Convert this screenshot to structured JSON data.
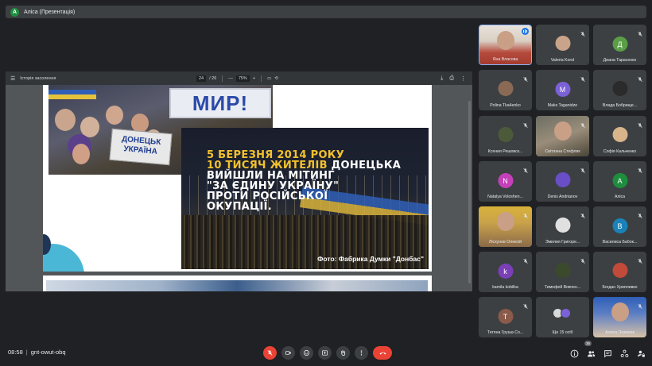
{
  "presenter": {
    "initial": "A",
    "label": "Аліса (Презентація)",
    "avatar_color": "#1e8e3e"
  },
  "pdf": {
    "title": "Історія засолення",
    "page_current": "24",
    "page_total": "/ 26",
    "zoom": "75%",
    "zoom_out": "—",
    "zoom_in": "+",
    "headline_lines": [
      {
        "text": "5 БЕРЕЗНЯ 2014 РОКУ",
        "color": "yellow"
      },
      {
        "text_y": "10 ТИСЯЧ ЖИТЕЛІВ ",
        "text_w": "ДОНЕЦЬКА"
      },
      {
        "text": "ВИЙШЛИ НА МІТИНГ",
        "color": "white"
      },
      {
        "text": "\"ЗА ЄДИНУ УКРАЇНУ\"",
        "color": "white"
      },
      {
        "text": "ПРОТИ РОСІЙСЬКОЇ",
        "color": "white"
      },
      {
        "text": "ОКУПАЦІЇ.",
        "color": "white"
      }
    ],
    "photo_caption": "Фото: Фабрика Думки \"Донбас\"",
    "sign_myr": "МИР!",
    "sign_donetsk": "ДОНЕЦЬК УКРАЇНА"
  },
  "participants": [
    {
      "name": "Яна Власова",
      "type": "video",
      "active": true,
      "speaking": true
    },
    {
      "name": "Valeria Korol",
      "type": "photo",
      "muted": true,
      "photo_color": "#c9a48a"
    },
    {
      "name": "Диана Тарасенко",
      "type": "letter",
      "initial": "Д",
      "color": "#5a9e46",
      "muted": true
    },
    {
      "name": "Polina Tka4enko",
      "type": "photo",
      "muted": true,
      "photo_color": "#8a6a55"
    },
    {
      "name": "Maks Taganidze",
      "type": "letter",
      "initial": "M",
      "color": "#7b61d8",
      "muted": true
    },
    {
      "name": "Влада Бобрище...",
      "type": "photo",
      "muted": true,
      "photo_color": "#2b2b2b"
    },
    {
      "name": "Ксения Решовск...",
      "type": "photo",
      "muted": true,
      "photo_color": "#4c5a3a"
    },
    {
      "name": "Світлана Стефляк",
      "type": "video",
      "muted": true
    },
    {
      "name": "Софія Кальченко",
      "type": "photo",
      "muted": true,
      "photo_color": "#d8b48a"
    },
    {
      "name": "Natalya Voloshen...",
      "type": "letter",
      "initial": "N",
      "color": "#c43fb8",
      "muted": true
    },
    {
      "name": "Denis Andrianov",
      "type": "photo",
      "muted": true,
      "photo_color": "#6a4ec7"
    },
    {
      "name": "Аліса",
      "type": "letter",
      "initial": "A",
      "color": "#1e8e3e",
      "muted": true
    },
    {
      "name": "Лісхунов Олексій",
      "type": "video",
      "muted": true
    },
    {
      "name": "Эмилия Григоре...",
      "type": "photo",
      "muted": true,
      "photo_color": "#e0e0e0"
    },
    {
      "name": "Василиса Бабок...",
      "type": "letter",
      "initial": "В",
      "color": "#1a82b8",
      "muted": true
    },
    {
      "name": "kamila kobilka",
      "type": "letter",
      "initial": "k",
      "color": "#7b3fb8",
      "muted": true
    },
    {
      "name": "Тимофей Вовчен...",
      "type": "photo",
      "muted": true,
      "photo_color": "#3b4a2c"
    },
    {
      "name": "Богдан Хрипливко",
      "type": "photo",
      "muted": true,
      "photo_color": "#c24a3a"
    },
    {
      "name": "Тетяна Груша Со...",
      "type": "letter",
      "initial": "T",
      "color": "#8a5a4a",
      "muted": true
    },
    {
      "name": "Ще 15 осіб",
      "type": "more"
    },
    {
      "name": "Алина Лазимак",
      "type": "video",
      "muted": true
    }
  ],
  "bottom": {
    "time": "08:58",
    "separator": "|",
    "meeting_code": "gnt-owut-obq",
    "participant_count": "36"
  },
  "colors": {
    "background": "#202124",
    "tile": "#3c4043",
    "danger": "#ea4335",
    "active_border": "#8ab4f8"
  }
}
